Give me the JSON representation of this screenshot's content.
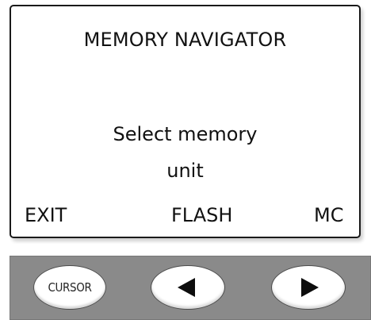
{
  "screen": {
    "title": "MEMORY NAVIGATOR",
    "message_line_1": "Select memory",
    "message_line_2": "unit",
    "softkeys": {
      "left": "EXIT",
      "center": "FLASH",
      "right": "MC"
    }
  },
  "hardware_buttons": {
    "cursor_label": "CURSOR",
    "left_icon": "left-arrow-icon",
    "right_icon": "right-arrow-icon"
  },
  "colors": {
    "button_bar": "#8a8a8a",
    "screen_border": "#1a1a1a",
    "text": "#111111"
  }
}
